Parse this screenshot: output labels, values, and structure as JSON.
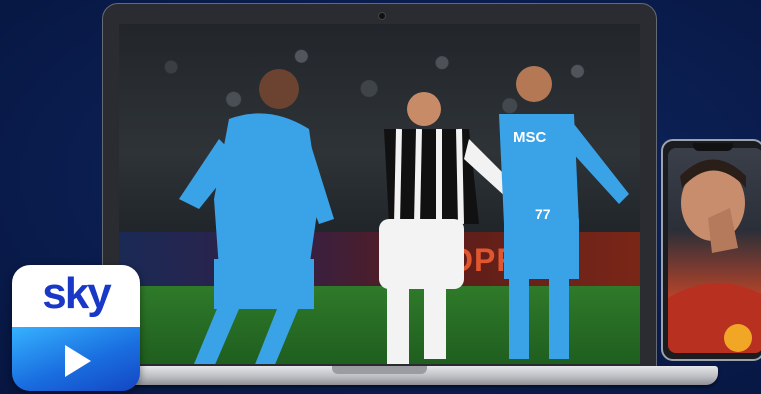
{
  "brand": {
    "name": "sky",
    "logo_colors": {
      "wordmark": "#1938c8",
      "top": "#ffffff",
      "bottom": "#1a6fe0"
    }
  },
  "scene": {
    "board_text": "COPRI D",
    "shirt_sponsor": "MSC",
    "shirt_number": "77"
  },
  "icons": {
    "play": "play-icon",
    "camera": "camera-icon"
  }
}
